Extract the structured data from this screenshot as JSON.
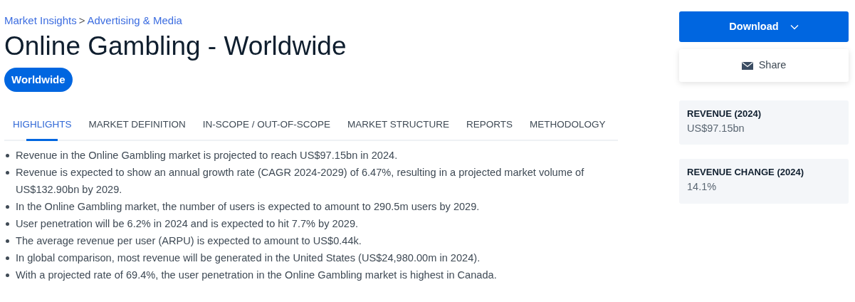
{
  "breadcrumb": {
    "separator": ">",
    "items": [
      {
        "label": "Market Insights"
      },
      {
        "label": "Advertising & Media"
      }
    ]
  },
  "title": "Online Gambling - Worldwide",
  "region_pill": "Worldwide",
  "tabs": [
    {
      "label": "HIGHLIGHTS",
      "selected": true
    },
    {
      "label": "MARKET DEFINITION",
      "selected": false
    },
    {
      "label": "IN-SCOPE / OUT-OF-SCOPE",
      "selected": false
    },
    {
      "label": "MARKET STRUCTURE",
      "selected": false
    },
    {
      "label": "REPORTS",
      "selected": false
    },
    {
      "label": "METHODOLOGY",
      "selected": false
    }
  ],
  "highlights": [
    "Revenue in the Online Gambling market is projected to reach US$97.15bn in 2024.",
    "Revenue is expected to show an annual growth rate (CAGR 2024-2029) of 6.47%, resulting in a projected market volume of US$132.90bn by 2029.",
    "In the Online Gambling market, the number of users is expected to amount to 290.5m users by 2029.",
    "User penetration will be 6.2% in 2024 and is expected to hit 7.7% by 2029.",
    "The average revenue per user (ARPU) is expected to amount to US$0.44k.",
    "In global comparison, most revenue will be generated in the United States (US$24,980.00m in 2024).",
    "With a projected rate of 69.4%, the user penetration in the Online Gambling market is highest in Canada."
  ],
  "actions": {
    "download": "Download",
    "share": "Share"
  },
  "kpis": [
    {
      "label": "REVENUE (2024)",
      "value": "US$97.15bn"
    },
    {
      "label": "REVENUE CHANGE (2024)",
      "value": "14.1%"
    }
  ]
}
